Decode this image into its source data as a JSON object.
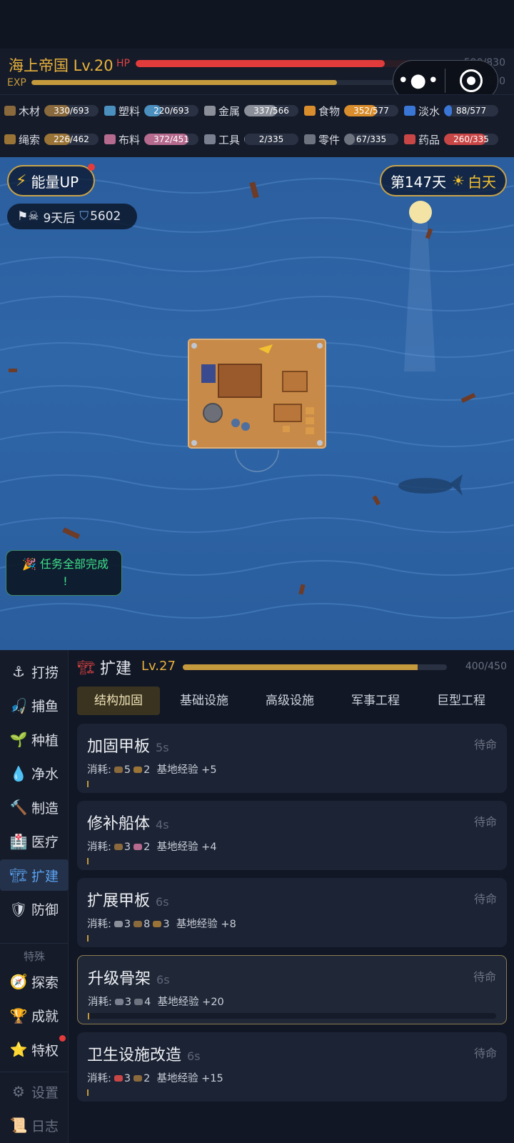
{
  "header": {
    "title": "海上帝国 Lv.20",
    "hp_label": "HP",
    "hp_value": "590/830",
    "hp_fraction": 0.71,
    "exp_label": "EXP",
    "exp_value": "1?/2500",
    "exp_fraction": 0.68
  },
  "resources": [
    {
      "name": "木材",
      "value": "330/693",
      "fraction": 0.48,
      "color": "#8a6a3c",
      "icon": "wood-icon"
    },
    {
      "name": "塑料",
      "value": "220/693",
      "fraction": 0.32,
      "color": "#4b8fbf",
      "icon": "plastic-bottle-icon"
    },
    {
      "name": "金属",
      "value": "337/566",
      "fraction": 0.6,
      "color": "#8b8f99",
      "icon": "gear-icon"
    },
    {
      "name": "食物",
      "value": "352/577",
      "fraction": 0.61,
      "color": "#d98d2c",
      "icon": "food-icon"
    },
    {
      "name": "淡水",
      "value": "88/577",
      "fraction": 0.15,
      "color": "#3a76d6",
      "icon": "water-drop-icon"
    },
    {
      "name": "绳索",
      "value": "226/462",
      "fraction": 0.49,
      "color": "#9a7436",
      "icon": "rope-icon"
    },
    {
      "name": "布料",
      "value": "372/451",
      "fraction": 0.82,
      "color": "#b56a8e",
      "icon": "cloth-icon"
    },
    {
      "name": "工具",
      "value": "2/335",
      "fraction": 0.01,
      "color": "#7a8090",
      "icon": "wrench-icon"
    },
    {
      "name": "零件",
      "value": "67/335",
      "fraction": 0.2,
      "color": "#6e7380",
      "icon": "parts-icon"
    },
    {
      "name": "药品",
      "value": "260/335",
      "fraction": 0.78,
      "color": "#c84646",
      "icon": "medicine-icon"
    }
  ],
  "sea": {
    "energy_label": "能量UP",
    "day_label": "第147天",
    "day_phase": "白天",
    "pirate_text": "9天后",
    "pirate_power": "5602",
    "quest_text": "任务全部完成",
    "quest_mark": "!"
  },
  "sidebar": {
    "items": [
      {
        "label": "打捞",
        "icon": "anchor-icon"
      },
      {
        "label": "捕鱼",
        "icon": "fishing-rod-icon"
      },
      {
        "label": "种植",
        "icon": "sprout-icon"
      },
      {
        "label": "净水",
        "icon": "water-drop-icon"
      },
      {
        "label": "制造",
        "icon": "hammer-icon"
      },
      {
        "label": "医疗",
        "icon": "hospital-icon"
      },
      {
        "label": "扩建",
        "icon": "crane-icon"
      },
      {
        "label": "防御",
        "icon": "shield-icon"
      }
    ],
    "special_heading": "特殊",
    "special": [
      {
        "label": "探索",
        "icon": "compass-icon"
      },
      {
        "label": "成就",
        "icon": "trophy-icon"
      },
      {
        "label": "特权",
        "icon": "star-icon"
      }
    ],
    "bottom": [
      {
        "label": "设置",
        "icon": "gear-icon"
      },
      {
        "label": "日志",
        "icon": "scroll-icon"
      }
    ]
  },
  "category": {
    "name": "扩建",
    "level": "Lv.27",
    "progress": "400/450",
    "fraction": 0.89
  },
  "tabs": [
    "结构加固",
    "基础设施",
    "高级设施",
    "军事工程",
    "巨型工程"
  ],
  "tasks": [
    {
      "name": "加固甲板",
      "time": "5s",
      "status": "待命",
      "cost_label": "消耗:",
      "costs": [
        {
          "color": "#8a6a3c",
          "n": "5"
        },
        {
          "color": "#9a7436",
          "n": "2"
        }
      ],
      "reward": "基地经验 +5"
    },
    {
      "name": "修补船体",
      "time": "4s",
      "status": "待命",
      "cost_label": "消耗:",
      "costs": [
        {
          "color": "#8a6a3c",
          "n": "3"
        },
        {
          "color": "#b56a8e",
          "n": "2"
        }
      ],
      "reward": "基地经验 +4"
    },
    {
      "name": "扩展甲板",
      "time": "6s",
      "status": "待命",
      "cost_label": "消耗:",
      "costs": [
        {
          "color": "#8b8f99",
          "n": "3"
        },
        {
          "color": "#8a6a3c",
          "n": "8"
        },
        {
          "color": "#9a7436",
          "n": "3"
        }
      ],
      "reward": "基地经验 +8"
    },
    {
      "name": "升级骨架",
      "time": "6s",
      "status": "待命",
      "cost_label": "消耗:",
      "costs": [
        {
          "color": "#7a8090",
          "n": "3"
        },
        {
          "color": "#6e7380",
          "n": "4"
        }
      ],
      "reward": "基地经验 +20"
    },
    {
      "name": "卫生设施改造",
      "time": "6s",
      "status": "待命",
      "cost_label": "消耗:",
      "costs": [
        {
          "color": "#c84646",
          "n": "3"
        },
        {
          "color": "#8a6a3c",
          "n": "2"
        }
      ],
      "reward": "基地经验 +15"
    }
  ]
}
